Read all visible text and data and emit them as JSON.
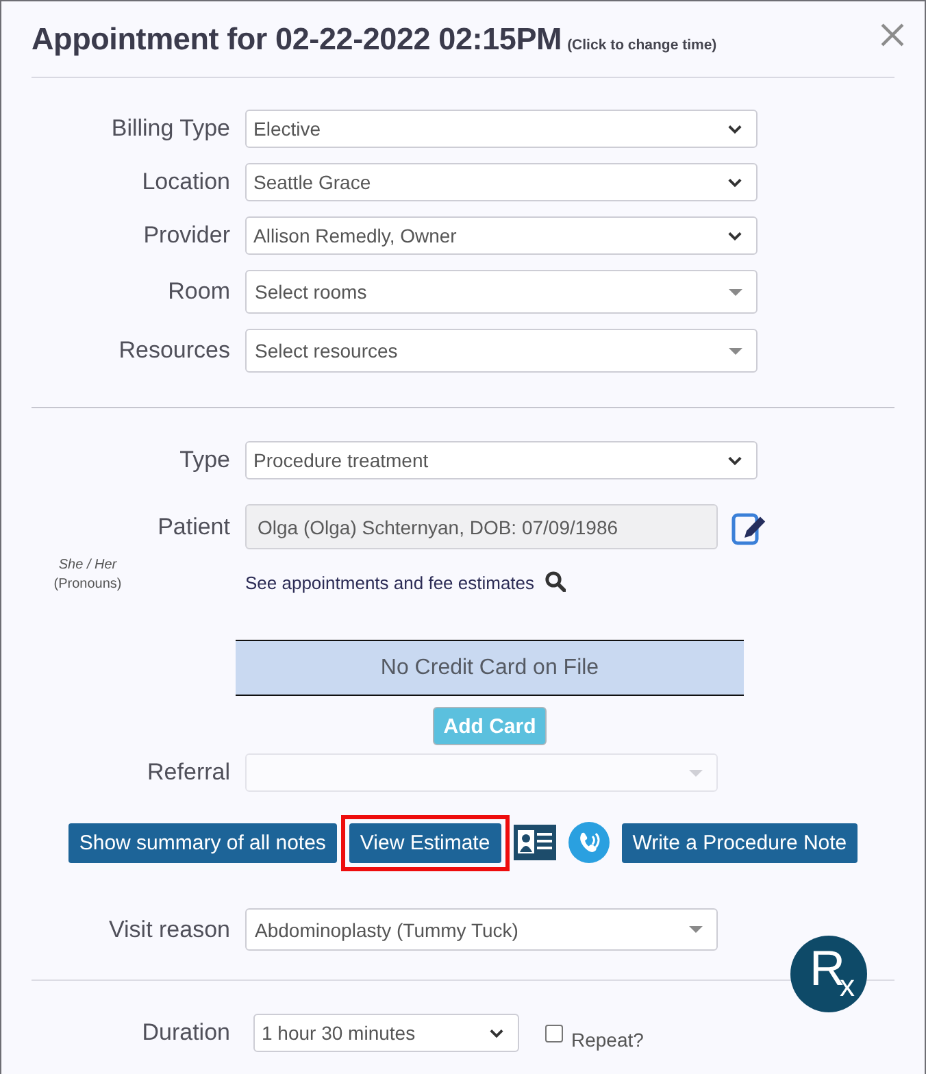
{
  "dialog": {
    "title": "Appointment for 02-22-2022 02:15PM",
    "title_note": "(Click to change time)"
  },
  "scheduling": [
    {
      "kind": "select",
      "label": "Billing Type",
      "value": "Elective"
    },
    {
      "kind": "select",
      "label": "Location",
      "value": "Seattle Grace"
    },
    {
      "kind": "select",
      "label": "Provider",
      "value": "Allison Remedly, Owner"
    },
    {
      "kind": "combo",
      "label": "Room",
      "placeholder": "Select rooms"
    },
    {
      "kind": "combo",
      "label": "Resources",
      "placeholder": "Select resources"
    }
  ],
  "type": {
    "kind": "select",
    "label": "Type",
    "value": "Procedure treatment"
  },
  "patient": {
    "kind": "text",
    "label": "Patient",
    "value": "Olga (Olga) Schternyan, DOB: 07/09/1986",
    "disabled": true,
    "pronouns": "She / Her",
    "pronouns_caption": "(Pronouns)",
    "link": "See appointments and fee estimates"
  },
  "credit_card": {
    "message": "No Credit Card on File",
    "button": "Add Card"
  },
  "referral": {
    "kind": "combo",
    "label": "Referral",
    "disabled": true
  },
  "actions": [
    {
      "kind": "button",
      "label": "Show summary of all notes",
      "highlighted": false
    },
    {
      "kind": "button",
      "label": "View Estimate",
      "highlighted": true
    },
    {
      "kind": "contact"
    },
    {
      "kind": "call"
    },
    {
      "kind": "button",
      "label": "Write a Procedure Note",
      "highlighted": false
    }
  ],
  "visit_reason": {
    "kind": "combo",
    "label": "Visit reason",
    "value": "Abdominoplasty (Tummy Tuck)"
  },
  "rx_button": {
    "label": "R$_{x}$"
  },
  "duration": {
    "kind": "select",
    "label": "Duration",
    "value": "1 hour 30 minutes",
    "repeat": {
      "label": "Repeat?",
      "checked": false
    }
  }
}
